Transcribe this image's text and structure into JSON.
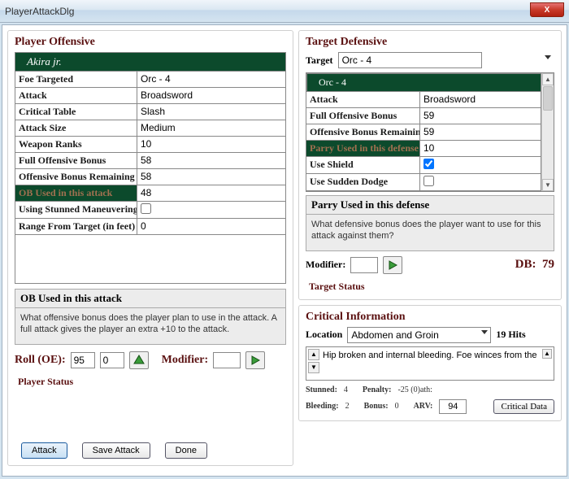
{
  "window": {
    "title": "PlayerAttackDlg",
    "close": "X"
  },
  "offensive": {
    "title": "Player Offensive",
    "character": "Akira jr.",
    "rows": [
      {
        "label": "Foe Targeted",
        "value": "Orc - 4"
      },
      {
        "label": "Attack",
        "value": "Broadsword"
      },
      {
        "label": "Critical Table",
        "value": "Slash"
      },
      {
        "label": "Attack Size",
        "value": "Medium"
      },
      {
        "label": "Weapon Ranks",
        "value": "10"
      },
      {
        "label": "Full Offensive Bonus",
        "value": "58"
      },
      {
        "label": "Offensive Bonus Remaining",
        "value": "58"
      },
      {
        "label": "OB Used in this attack",
        "value": "48",
        "selected": true
      },
      {
        "label": "Using Stunned Maneuvering",
        "value": "",
        "checkbox": true,
        "checked": false
      },
      {
        "label": "Range From Target  (in feet)",
        "value": "0"
      }
    ],
    "help": {
      "title": "OB Used in this attack",
      "text": "What offensive bonus does the player plan to use in the attack. A full attack gives the player an extra +10 to the attack."
    },
    "roll_label": "Roll (OE):",
    "roll_a": "95",
    "roll_b": "0",
    "modifier_label": "Modifier:",
    "modifier": "",
    "status_label": "Player Status",
    "buttons": {
      "attack": "Attack",
      "save": "Save Attack",
      "done": "Done"
    }
  },
  "defensive": {
    "title": "Target Defensive",
    "target_label": "Target",
    "target_value": "Orc - 4",
    "character": "Orc - 4",
    "rows": [
      {
        "label": "Attack",
        "value": "Broadsword"
      },
      {
        "label": "Full Offensive Bonus",
        "value": "59"
      },
      {
        "label": "Offensive Bonus Remaining",
        "value": "59"
      },
      {
        "label": "Parry Used in this defense",
        "value": "10",
        "selected": true
      },
      {
        "label": "Use Shield",
        "value": "",
        "checkbox": true,
        "checked": true
      },
      {
        "label": "Use Sudden Dodge",
        "value": "",
        "checkbox": true,
        "checked": false
      }
    ],
    "help": {
      "title": "Parry Used in this defense",
      "text": "What defensive bonus does the player want to use for this attack against them?"
    },
    "modifier_label": "Modifier:",
    "modifier": "",
    "db_label": "DB:",
    "db_value": "79",
    "status_label": "Target Status"
  },
  "critical": {
    "title": "Critical Information",
    "location_label": "Location",
    "location_value": "Abdomen and Groin",
    "hits": "19 Hits",
    "description": "Hip broken and internal bleeding. Foe winces from the",
    "stats": {
      "stunned_l": "Stunned:",
      "stunned_v": "4",
      "penalty_l": "Penalty:",
      "penalty_v": "-25 (0)ath:",
      "bleeding_l": "Bleeding:",
      "bleeding_v": "2",
      "bonus_l": "Bonus:",
      "bonus_v": "0",
      "arv_l": "ARV:",
      "arv_v": "94"
    },
    "crit_data_btn": "Critical Data"
  }
}
